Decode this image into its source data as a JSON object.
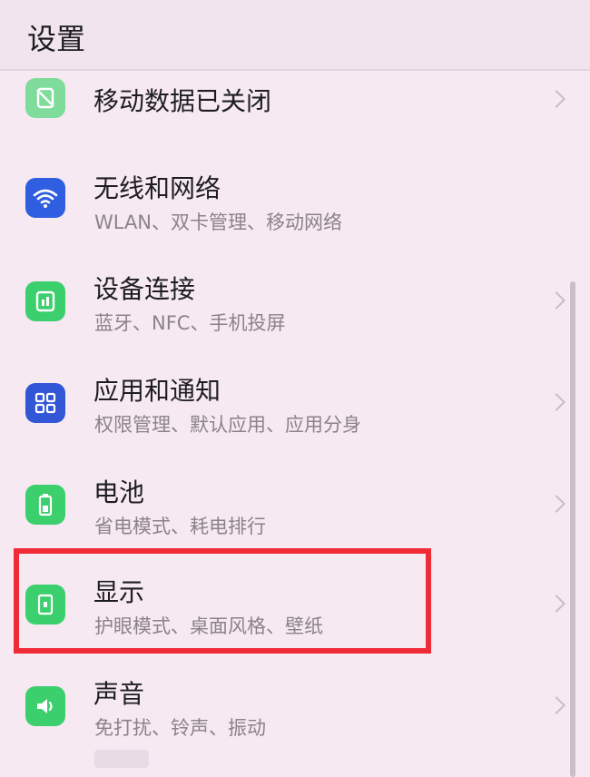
{
  "header": {
    "title": "设置"
  },
  "items": [
    {
      "title": "移动数据已关闭",
      "subtitle": "",
      "icon": "mobile-data-icon"
    },
    {
      "title": "无线和网络",
      "subtitle": "WLAN、双卡管理、移动网络",
      "icon": "wifi-icon"
    },
    {
      "title": "设备连接",
      "subtitle": "蓝牙、NFC、手机投屏",
      "icon": "device-connection-icon"
    },
    {
      "title": "应用和通知",
      "subtitle": "权限管理、默认应用、应用分身",
      "icon": "apps-icon"
    },
    {
      "title": "电池",
      "subtitle": "省电模式、耗电排行",
      "icon": "battery-icon"
    },
    {
      "title": "显示",
      "subtitle": "护眼模式、桌面风格、壁纸",
      "icon": "display-icon"
    },
    {
      "title": "声音",
      "subtitle": "免打扰、铃声、振动",
      "icon": "sound-icon"
    }
  ],
  "highlighted_item": "显示",
  "colors": {
    "accent_green": "#3ccf6e",
    "wifi_blue": "#2f5fe0",
    "apps_blue": "#3356d6",
    "highlight_red": "#ee2b36"
  }
}
